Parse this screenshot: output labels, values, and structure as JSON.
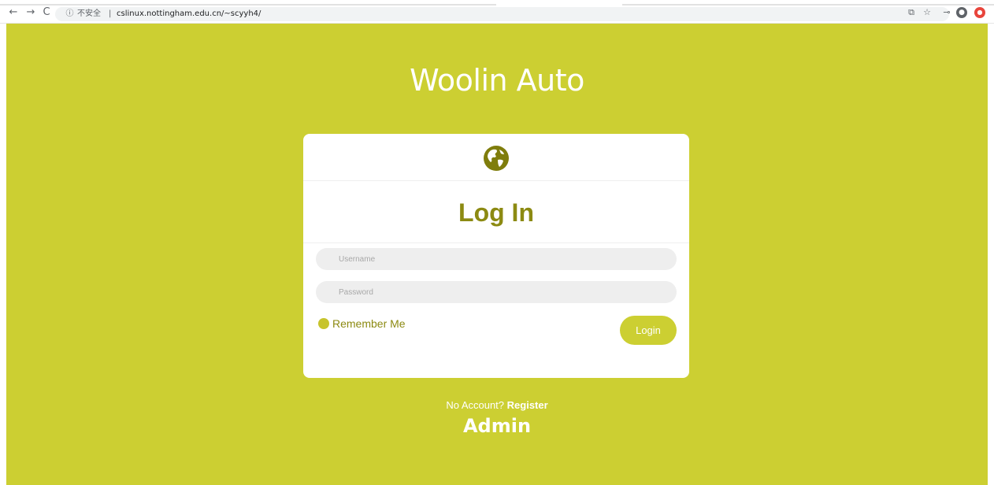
{
  "browser": {
    "back_icon": "arrow-left-icon",
    "forward_icon": "arrow-right-icon",
    "reload_icon": "reload-icon",
    "security_label": "不安全",
    "url": "cslinux.nottingham.edu.cn/~scyyh4/"
  },
  "page": {
    "background_color": "#cccf32",
    "site_title": "Woolin Auto"
  },
  "login_card": {
    "header_icon": "globe-icon",
    "title": "Log In",
    "username_placeholder": "Username",
    "password_placeholder": "Password",
    "remember_label": "Remember Me",
    "login_button_label": "Login",
    "accent_color": "#8c8a12"
  },
  "footer": {
    "no_account_text": "No Account?",
    "register_label": "Register",
    "admin_label": "Admin"
  }
}
